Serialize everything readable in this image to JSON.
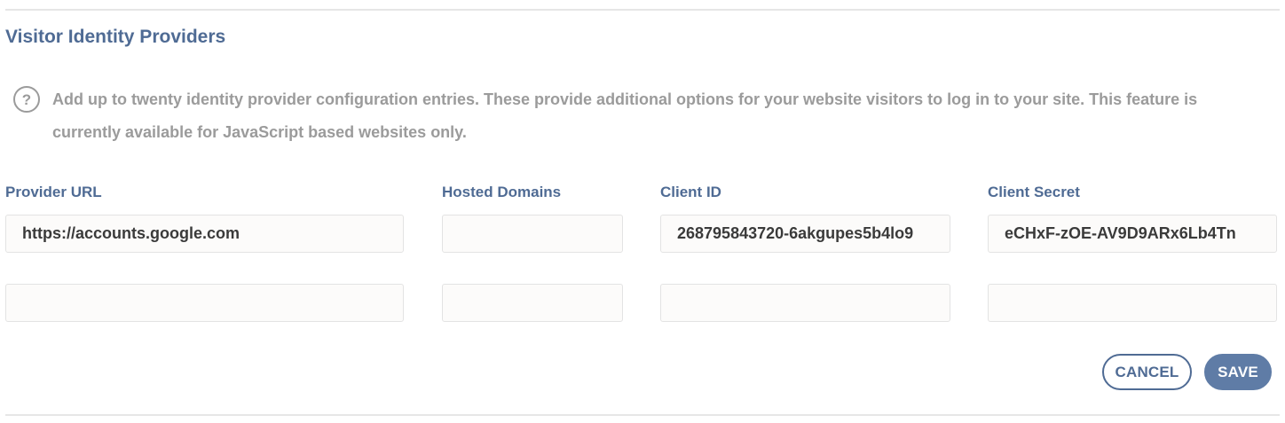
{
  "section": {
    "title": "Visitor Identity Providers",
    "help_icon": "question-circle-icon",
    "help_text": "Add up to twenty identity provider configuration entries. These provide additional options for your website visitors to log in to your site. This feature is currently available for JavaScript based websites only."
  },
  "columns": {
    "provider_url": "Provider URL",
    "hosted_domains": "Hosted Domains",
    "client_id": "Client ID",
    "client_secret": "Client Secret"
  },
  "rows": [
    {
      "provider_url": "https://accounts.google.com",
      "hosted_domains": "",
      "client_id": "268795843720-6akgupes5b4lo9",
      "client_secret": "eCHxF-zOE-AV9D9ARx6Lb4Tn"
    },
    {
      "provider_url": "",
      "hosted_domains": "",
      "client_id": "",
      "client_secret": ""
    }
  ],
  "actions": {
    "cancel_label": "CANCEL",
    "save_label": "SAVE"
  },
  "colors": {
    "accent": "#4f6b94",
    "save_button": "#5f7ca6",
    "muted_text": "#9b9b9b"
  }
}
